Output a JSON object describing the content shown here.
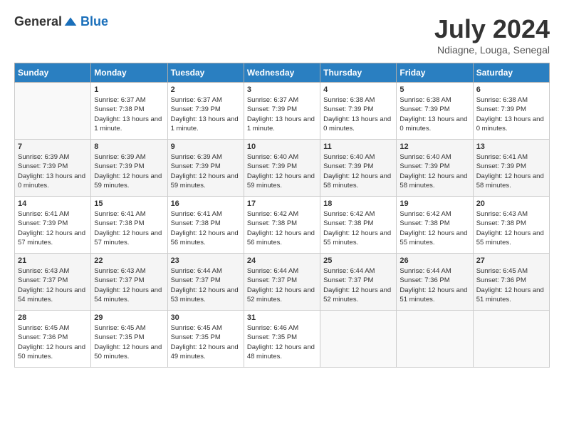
{
  "header": {
    "logo_general": "General",
    "logo_blue": "Blue",
    "title": "July 2024",
    "location": "Ndiagne, Louga, Senegal"
  },
  "days_of_week": [
    "Sunday",
    "Monday",
    "Tuesday",
    "Wednesday",
    "Thursday",
    "Friday",
    "Saturday"
  ],
  "weeks": [
    [
      {
        "day": "",
        "sunrise": "",
        "sunset": "",
        "daylight": ""
      },
      {
        "day": "1",
        "sunrise": "Sunrise: 6:37 AM",
        "sunset": "Sunset: 7:38 PM",
        "daylight": "Daylight: 13 hours and 1 minute."
      },
      {
        "day": "2",
        "sunrise": "Sunrise: 6:37 AM",
        "sunset": "Sunset: 7:39 PM",
        "daylight": "Daylight: 13 hours and 1 minute."
      },
      {
        "day": "3",
        "sunrise": "Sunrise: 6:37 AM",
        "sunset": "Sunset: 7:39 PM",
        "daylight": "Daylight: 13 hours and 1 minute."
      },
      {
        "day": "4",
        "sunrise": "Sunrise: 6:38 AM",
        "sunset": "Sunset: 7:39 PM",
        "daylight": "Daylight: 13 hours and 0 minutes."
      },
      {
        "day": "5",
        "sunrise": "Sunrise: 6:38 AM",
        "sunset": "Sunset: 7:39 PM",
        "daylight": "Daylight: 13 hours and 0 minutes."
      },
      {
        "day": "6",
        "sunrise": "Sunrise: 6:38 AM",
        "sunset": "Sunset: 7:39 PM",
        "daylight": "Daylight: 13 hours and 0 minutes."
      }
    ],
    [
      {
        "day": "7",
        "sunrise": "Sunrise: 6:39 AM",
        "sunset": "Sunset: 7:39 PM",
        "daylight": "Daylight: 13 hours and 0 minutes."
      },
      {
        "day": "8",
        "sunrise": "Sunrise: 6:39 AM",
        "sunset": "Sunset: 7:39 PM",
        "daylight": "Daylight: 12 hours and 59 minutes."
      },
      {
        "day": "9",
        "sunrise": "Sunrise: 6:39 AM",
        "sunset": "Sunset: 7:39 PM",
        "daylight": "Daylight: 12 hours and 59 minutes."
      },
      {
        "day": "10",
        "sunrise": "Sunrise: 6:40 AM",
        "sunset": "Sunset: 7:39 PM",
        "daylight": "Daylight: 12 hours and 59 minutes."
      },
      {
        "day": "11",
        "sunrise": "Sunrise: 6:40 AM",
        "sunset": "Sunset: 7:39 PM",
        "daylight": "Daylight: 12 hours and 58 minutes."
      },
      {
        "day": "12",
        "sunrise": "Sunrise: 6:40 AM",
        "sunset": "Sunset: 7:39 PM",
        "daylight": "Daylight: 12 hours and 58 minutes."
      },
      {
        "day": "13",
        "sunrise": "Sunrise: 6:41 AM",
        "sunset": "Sunset: 7:39 PM",
        "daylight": "Daylight: 12 hours and 58 minutes."
      }
    ],
    [
      {
        "day": "14",
        "sunrise": "Sunrise: 6:41 AM",
        "sunset": "Sunset: 7:39 PM",
        "daylight": "Daylight: 12 hours and 57 minutes."
      },
      {
        "day": "15",
        "sunrise": "Sunrise: 6:41 AM",
        "sunset": "Sunset: 7:38 PM",
        "daylight": "Daylight: 12 hours and 57 minutes."
      },
      {
        "day": "16",
        "sunrise": "Sunrise: 6:41 AM",
        "sunset": "Sunset: 7:38 PM",
        "daylight": "Daylight: 12 hours and 56 minutes."
      },
      {
        "day": "17",
        "sunrise": "Sunrise: 6:42 AM",
        "sunset": "Sunset: 7:38 PM",
        "daylight": "Daylight: 12 hours and 56 minutes."
      },
      {
        "day": "18",
        "sunrise": "Sunrise: 6:42 AM",
        "sunset": "Sunset: 7:38 PM",
        "daylight": "Daylight: 12 hours and 55 minutes."
      },
      {
        "day": "19",
        "sunrise": "Sunrise: 6:42 AM",
        "sunset": "Sunset: 7:38 PM",
        "daylight": "Daylight: 12 hours and 55 minutes."
      },
      {
        "day": "20",
        "sunrise": "Sunrise: 6:43 AM",
        "sunset": "Sunset: 7:38 PM",
        "daylight": "Daylight: 12 hours and 55 minutes."
      }
    ],
    [
      {
        "day": "21",
        "sunrise": "Sunrise: 6:43 AM",
        "sunset": "Sunset: 7:37 PM",
        "daylight": "Daylight: 12 hours and 54 minutes."
      },
      {
        "day": "22",
        "sunrise": "Sunrise: 6:43 AM",
        "sunset": "Sunset: 7:37 PM",
        "daylight": "Daylight: 12 hours and 54 minutes."
      },
      {
        "day": "23",
        "sunrise": "Sunrise: 6:44 AM",
        "sunset": "Sunset: 7:37 PM",
        "daylight": "Daylight: 12 hours and 53 minutes."
      },
      {
        "day": "24",
        "sunrise": "Sunrise: 6:44 AM",
        "sunset": "Sunset: 7:37 PM",
        "daylight": "Daylight: 12 hours and 52 minutes."
      },
      {
        "day": "25",
        "sunrise": "Sunrise: 6:44 AM",
        "sunset": "Sunset: 7:37 PM",
        "daylight": "Daylight: 12 hours and 52 minutes."
      },
      {
        "day": "26",
        "sunrise": "Sunrise: 6:44 AM",
        "sunset": "Sunset: 7:36 PM",
        "daylight": "Daylight: 12 hours and 51 minutes."
      },
      {
        "day": "27",
        "sunrise": "Sunrise: 6:45 AM",
        "sunset": "Sunset: 7:36 PM",
        "daylight": "Daylight: 12 hours and 51 minutes."
      }
    ],
    [
      {
        "day": "28",
        "sunrise": "Sunrise: 6:45 AM",
        "sunset": "Sunset: 7:36 PM",
        "daylight": "Daylight: 12 hours and 50 minutes."
      },
      {
        "day": "29",
        "sunrise": "Sunrise: 6:45 AM",
        "sunset": "Sunset: 7:35 PM",
        "daylight": "Daylight: 12 hours and 50 minutes."
      },
      {
        "day": "30",
        "sunrise": "Sunrise: 6:45 AM",
        "sunset": "Sunset: 7:35 PM",
        "daylight": "Daylight: 12 hours and 49 minutes."
      },
      {
        "day": "31",
        "sunrise": "Sunrise: 6:46 AM",
        "sunset": "Sunset: 7:35 PM",
        "daylight": "Daylight: 12 hours and 48 minutes."
      },
      {
        "day": "",
        "sunrise": "",
        "sunset": "",
        "daylight": ""
      },
      {
        "day": "",
        "sunrise": "",
        "sunset": "",
        "daylight": ""
      },
      {
        "day": "",
        "sunrise": "",
        "sunset": "",
        "daylight": ""
      }
    ]
  ]
}
